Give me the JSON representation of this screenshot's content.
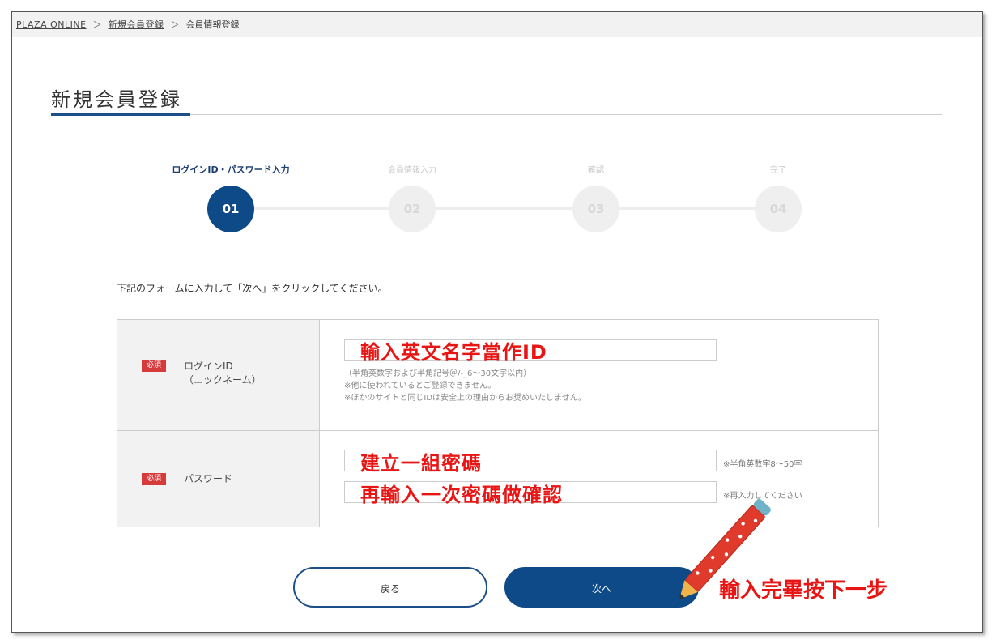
{
  "breadcrumb": {
    "home": "PLAZA ONLINE",
    "parent": "新規会員登録",
    "current": "会員情報登録",
    "sep1": "＞",
    "sep2": "＞"
  },
  "page": {
    "title": "新規会員登録"
  },
  "steps": [
    {
      "label": "ログインID・パスワード入力",
      "number": "01",
      "active": true
    },
    {
      "label": "会員情報入力",
      "number": "02",
      "active": false
    },
    {
      "label": "確認",
      "number": "03",
      "active": false
    },
    {
      "label": "完了",
      "number": "04",
      "active": false
    }
  ],
  "instruction": "下記のフォームに入力して「次へ」をクリックしてください。",
  "form": {
    "login": {
      "required": "必須",
      "label1": "ログインID",
      "label2": "（ニックネーム）",
      "overlay": "輸入英文名字當作ID",
      "hints": [
        "（半角英数字および半角記号＠/-_6〜30文字以内）",
        "※他に使われているとご登録できません。",
        "※ほかのサイトと同じIDは安全上の理由からお奨めいたしません。"
      ]
    },
    "password": {
      "required": "必須",
      "label": "パスワード",
      "overlay1": "建立一組密碼",
      "overlay2": "再輸入一次密碼做確認",
      "note1": "※半角英数字8〜50字",
      "note2": "※再入力してください"
    }
  },
  "buttons": {
    "back": "戻る",
    "next": "次へ"
  },
  "annotation": {
    "next_hint": "輸入完畢按下一步"
  },
  "colors": {
    "accent": "#0e4a87",
    "required": "#d63a3a",
    "annotation": "#e81515"
  }
}
